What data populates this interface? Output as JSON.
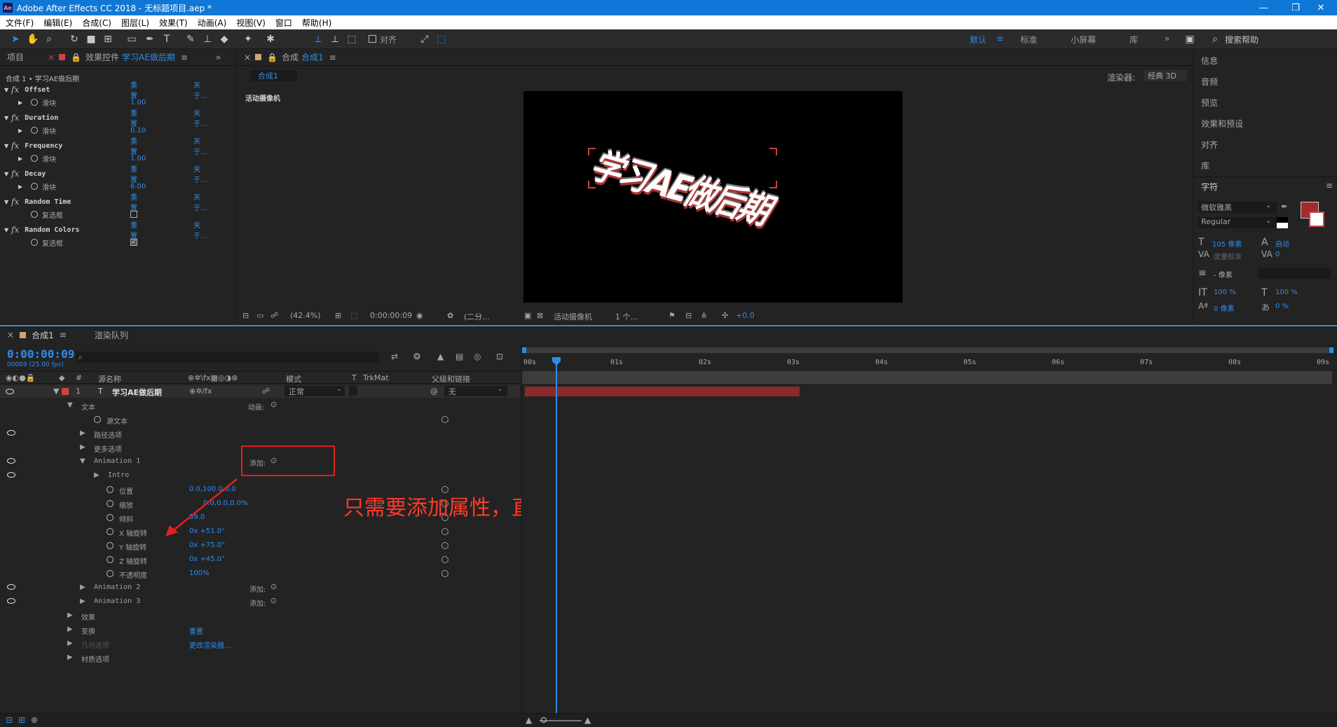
{
  "window": {
    "title": "Adobe After Effects CC 2018 - 无标题项目.aep *",
    "min": "—",
    "max": "❐",
    "close": "✕"
  },
  "menu": [
    "文件(F)",
    "编辑(E)",
    "合成(C)",
    "图层(L)",
    "效果(T)",
    "动画(A)",
    "视图(V)",
    "窗口",
    "帮助(H)"
  ],
  "toolbar": {
    "snap": "对齐",
    "workspaces": [
      "默认",
      "标准",
      "小屏幕",
      "库"
    ],
    "search_placeholder": "搜索帮助"
  },
  "effects_panel": {
    "tab_project": "项目",
    "tab_effects": "效果控件",
    "layer_name": "学习AE做后期",
    "breadcrumb": "合成 1 • 学习AE做后期",
    "effects": [
      {
        "name": "Offset",
        "reset": "重置",
        "about": "关于...",
        "param": "滑块",
        "value": "1.00"
      },
      {
        "name": "Duration",
        "reset": "重置",
        "about": "关于...",
        "param": "滑块",
        "value": "0.10"
      },
      {
        "name": "Frequency",
        "reset": "重置",
        "about": "关于...",
        "param": "滑块",
        "value": "1.00"
      },
      {
        "name": "Decay",
        "reset": "重置",
        "about": "关于...",
        "param": "滑块",
        "value": "6.00"
      },
      {
        "name": "Random Time",
        "reset": "重置",
        "about": "关于...",
        "param": "复选框",
        "value": ""
      },
      {
        "name": "Random Colors",
        "reset": "重置",
        "about": "关于...",
        "param": "复选框",
        "value": ""
      }
    ]
  },
  "comp_panel": {
    "tab": "合成",
    "tab_name": "合成1",
    "sub_tab": "合成1",
    "renderer_label": "渲染器:",
    "renderer": "经典 3D",
    "camera_label": "活动摄像机",
    "preview_text": "学习AE做后期",
    "footer": {
      "zoom": "(42.4%)",
      "time": "0:00:00:09",
      "quality": "(二分...",
      "camera": "活动摄像机",
      "views": "1 个...",
      "exposure": "+0.0"
    }
  },
  "right_panel": {
    "items": [
      "信息",
      "音频",
      "预览",
      "效果和预设",
      "对齐",
      "库"
    ],
    "char_title": "字符",
    "font": "微软雅黑",
    "style": "Regular",
    "size": "105 像素",
    "leading": "自动",
    "kerning": "度量标准",
    "tracking": "0",
    "stroke_unit": "- 像素",
    "vscale": "100 %",
    "hscale": "100 %",
    "baseline": "0 像素",
    "tsume": "0 %",
    "fill_color": "#a52a2a"
  },
  "timeline": {
    "tab": "合成1",
    "render_queue": "渲染队列",
    "timecode": "0:00:00:09",
    "fps": "00009 (25.00 fps)",
    "search_placeholder": "",
    "col_source": "源名称",
    "col_mode": "模式",
    "col_trk": "TrkMat",
    "col_parent": "父级和链接",
    "col_t": "T",
    "col_num": "#",
    "layer": {
      "num": "1",
      "type": "T",
      "name": "学习AE做后期",
      "mode": "正常",
      "parent": "无"
    },
    "rows": [
      {
        "label": "文本",
        "extra": "动画:"
      },
      {
        "label": "源文本"
      },
      {
        "label": "路径选项"
      },
      {
        "label": "更多选项"
      },
      {
        "label": "Animation 1",
        "extra": "添加:"
      },
      {
        "label": "Intro"
      },
      {
        "label": "位置",
        "value": "0.0,100.0,0.0"
      },
      {
        "label": "缩放",
        "value": "0.0,0.0,0.0%"
      },
      {
        "label": "倾斜",
        "value": "59.0"
      },
      {
        "label": "X 轴旋转",
        "value": "0x +51.0°"
      },
      {
        "label": "Y 轴旋转",
        "value": "0x +75.0°"
      },
      {
        "label": "Z 轴旋转",
        "value": "0x +45.0°"
      },
      {
        "label": "不透明度",
        "value": "100%"
      },
      {
        "label": "Animation 2",
        "extra": "添加:"
      },
      {
        "label": "Animation 3",
        "extra": "添加:"
      },
      {
        "label": "效果"
      },
      {
        "label": "变换",
        "value": "重置"
      },
      {
        "label": "几何选项",
        "value": "更改渲染器..."
      },
      {
        "label": "材质选项"
      }
    ],
    "ruler": [
      "00s",
      "01s",
      "02s",
      "03s",
      "04s",
      "05s",
      "06s",
      "07s",
      "08s",
      "09s"
    ],
    "annotation": "只需要添加属性，直接修改值即可，不需要添加关键帧"
  }
}
